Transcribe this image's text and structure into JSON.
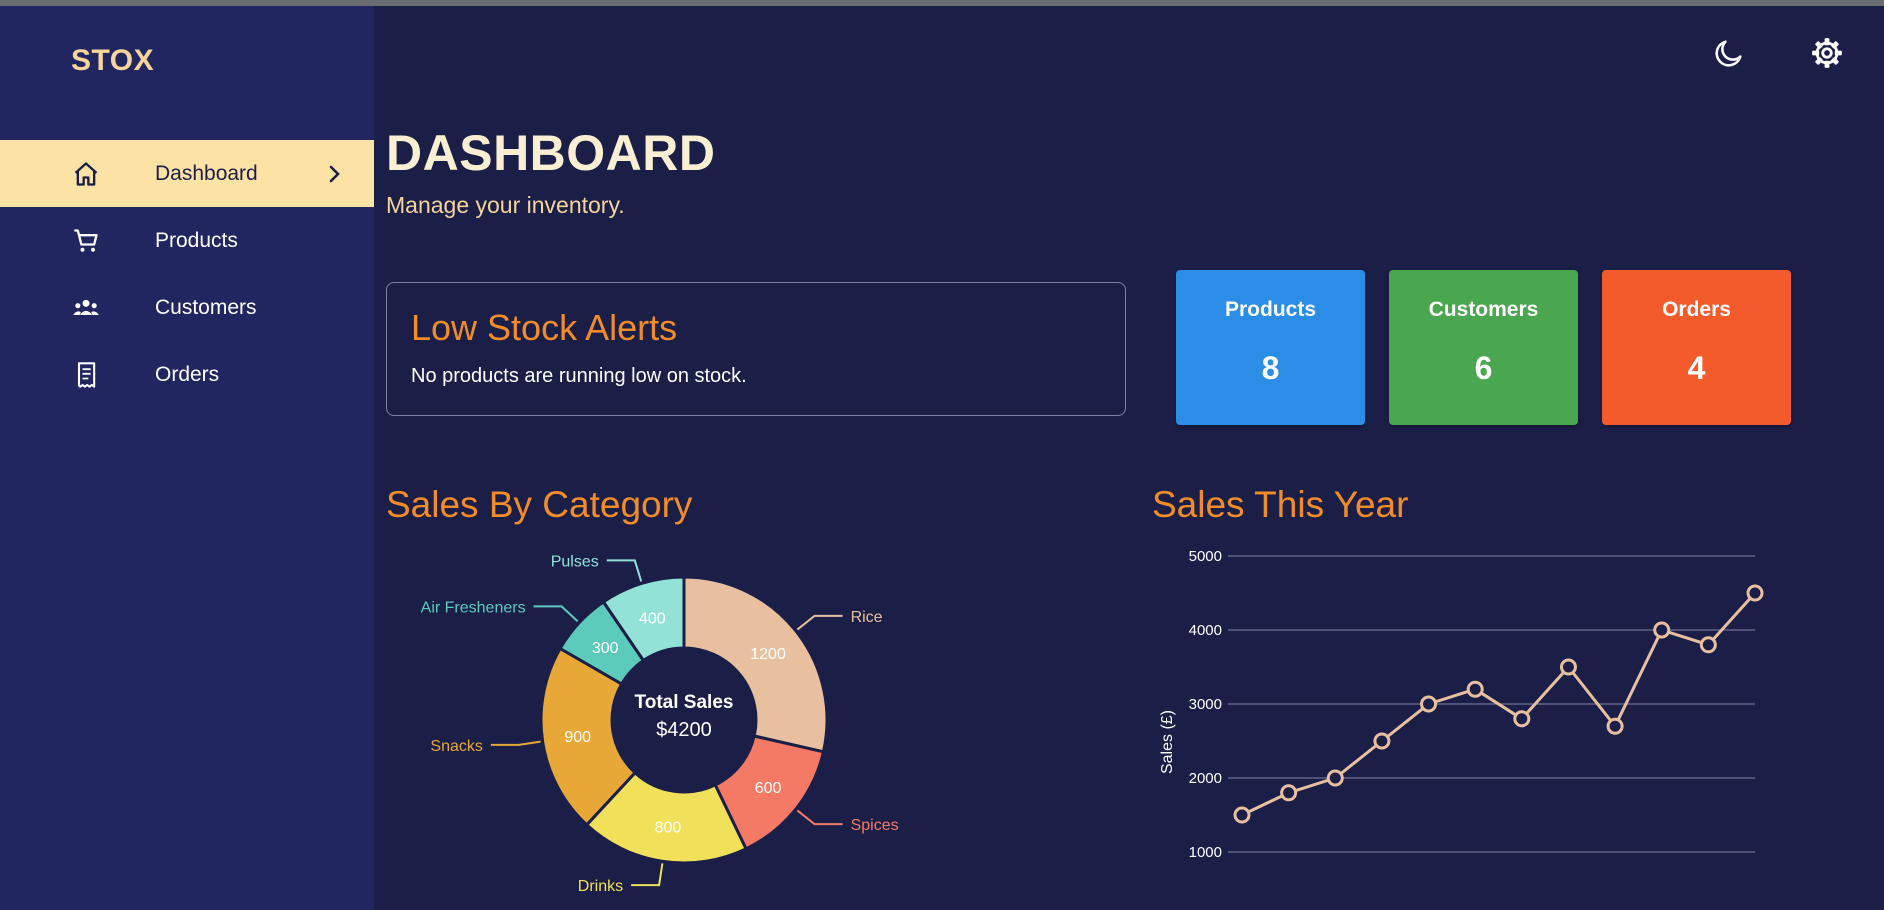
{
  "app": {
    "logo": "STOX"
  },
  "colors": {
    "sidebar": "#212660",
    "background": "#1b1f48",
    "accent_orange": "#f28c28",
    "active_nav": "#fde2a5"
  },
  "topbar": {
    "theme_icon": "moon-icon",
    "settings_icon": "gear-icon"
  },
  "sidebar": {
    "items": [
      {
        "label": "Dashboard",
        "icon": "home-icon",
        "active": true
      },
      {
        "label": "Products",
        "icon": "cart-icon"
      },
      {
        "label": "Customers",
        "icon": "people-icon"
      },
      {
        "label": "Orders",
        "icon": "receipt-icon"
      }
    ]
  },
  "header": {
    "title": "DASHBOARD",
    "subtitle": "Manage your inventory."
  },
  "low_stock": {
    "title": "Low Stock Alerts",
    "message": "No products are running low on stock."
  },
  "stats": [
    {
      "label": "Products",
      "value": "8",
      "color": "#2b8de5"
    },
    {
      "label": "Customers",
      "value": "6",
      "color": "#4ba650"
    },
    {
      "label": "Orders",
      "value": "4",
      "color": "#f35b2a"
    }
  ],
  "sections": {
    "category_title": "Sales By Category",
    "year_title": "Sales This Year"
  },
  "chart_data": [
    {
      "type": "pie",
      "title": "Sales By Category",
      "center_label": "Total Sales",
      "center_value": "$4200",
      "categories": [
        "Rice",
        "Spices",
        "Drinks",
        "Snacks",
        "Air Fresheners",
        "Pulses"
      ],
      "values": [
        1200,
        600,
        800,
        900,
        300,
        400
      ],
      "colors": [
        "#e8c0a0",
        "#f47a66",
        "#f0e05a",
        "#e8a838",
        "#5ccbbc",
        "#93e2d7"
      ]
    },
    {
      "type": "line",
      "title": "Sales This Year",
      "ylabel": "Sales (£)",
      "y_ticks": [
        "5000",
        "4000",
        "3000",
        "2000",
        "1000"
      ],
      "ylim": [
        1000,
        5000
      ],
      "values": [
        1500,
        1800,
        2000,
        2500,
        3000,
        3200,
        2800,
        3500,
        2700,
        4000,
        3800,
        4500
      ],
      "color": "#e8c0a0",
      "grid": true
    }
  ]
}
